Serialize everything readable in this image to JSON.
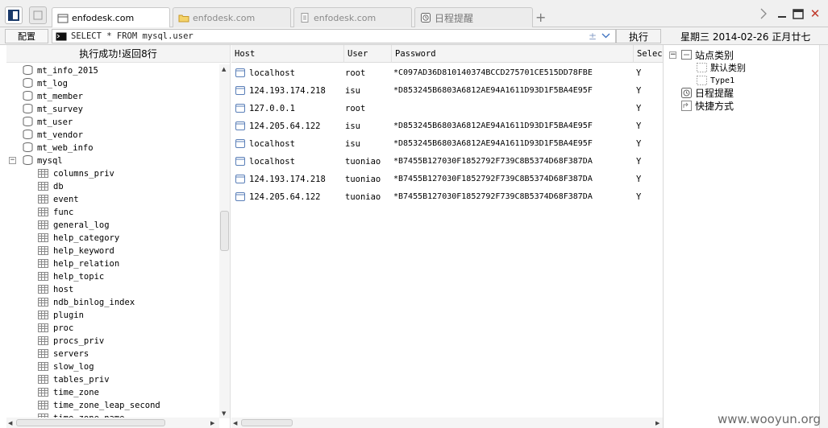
{
  "tabs": [
    {
      "label": "enfodesk.com",
      "active": true,
      "icon": "page-icon"
    },
    {
      "label": "enfodesk.com",
      "active": false,
      "icon": "folder-icon"
    },
    {
      "label": "enfodesk.com",
      "active": false,
      "icon": "document-icon"
    },
    {
      "label": "日程提醒",
      "active": false,
      "icon": "clock-icon"
    }
  ],
  "new_tab_label": "+",
  "window_controls": {
    "close": "✕"
  },
  "toolbar": {
    "config_label": "配置",
    "query_text": "SELECT * FROM mysql.user",
    "run_label": "执行",
    "date_text": "星期三 2014-02-26 正月廿七"
  },
  "left_panel": {
    "status": "执行成功!返回8行",
    "databases_above": [
      "mt_info_2015",
      "mt_log",
      "mt_member",
      "mt_survey",
      "mt_user",
      "mt_vendor",
      "mt_web_info"
    ],
    "expanded_db": "mysql",
    "expanded_db_toggle": "−",
    "tables": [
      "columns_priv",
      "db",
      "event",
      "func",
      "general_log",
      "help_category",
      "help_keyword",
      "help_relation",
      "help_topic",
      "host",
      "ndb_binlog_index",
      "plugin",
      "proc",
      "procs_priv",
      "servers",
      "slow_log",
      "tables_priv",
      "time_zone",
      "time_zone_leap_second",
      "time_zone_name"
    ]
  },
  "grid": {
    "columns": [
      "Host",
      "User",
      "Password",
      "Select_priv"
    ],
    "rows": [
      {
        "host": "localhost",
        "user": "root",
        "password": "*C097AD36D810140374BCCD275701CE515DD78FBE",
        "select": "Y"
      },
      {
        "host": "124.193.174.218",
        "user": "isu",
        "password": "*D853245B6803A6812AE94A1611D93D1F5BA4E95F",
        "select": "Y"
      },
      {
        "host": "127.0.0.1",
        "user": "root",
        "password": "",
        "select": "Y"
      },
      {
        "host": "124.205.64.122",
        "user": "isu",
        "password": "*D853245B6803A6812AE94A1611D93D1F5BA4E95F",
        "select": "Y"
      },
      {
        "host": "localhost",
        "user": "isu",
        "password": "*D853245B6803A6812AE94A1611D93D1F5BA4E95F",
        "select": "Y"
      },
      {
        "host": "localhost",
        "user": "tuoniao",
        "password": "*B7455B127030F1852792F739C8B5374D68F387DA",
        "select": "Y"
      },
      {
        "host": "124.193.174.218",
        "user": "tuoniao",
        "password": "*B7455B127030F1852792F739C8B5374D68F387DA",
        "select": "Y"
      },
      {
        "host": "124.205.64.122",
        "user": "tuoniao",
        "password": "*B7455B127030F1852792F739C8B5374D68F387DA",
        "select": "Y"
      }
    ]
  },
  "right_panel": {
    "site_category": "站点类别",
    "site_category_toggle": "−",
    "default_category": "默认类别",
    "type1": "Type1",
    "schedule": "日程提醒",
    "shortcut": "快捷方式"
  },
  "watermark": "www.wooyun.org",
  "colors": {
    "accent_close": "#c0392b",
    "link_blue": "#3a6fbf"
  }
}
